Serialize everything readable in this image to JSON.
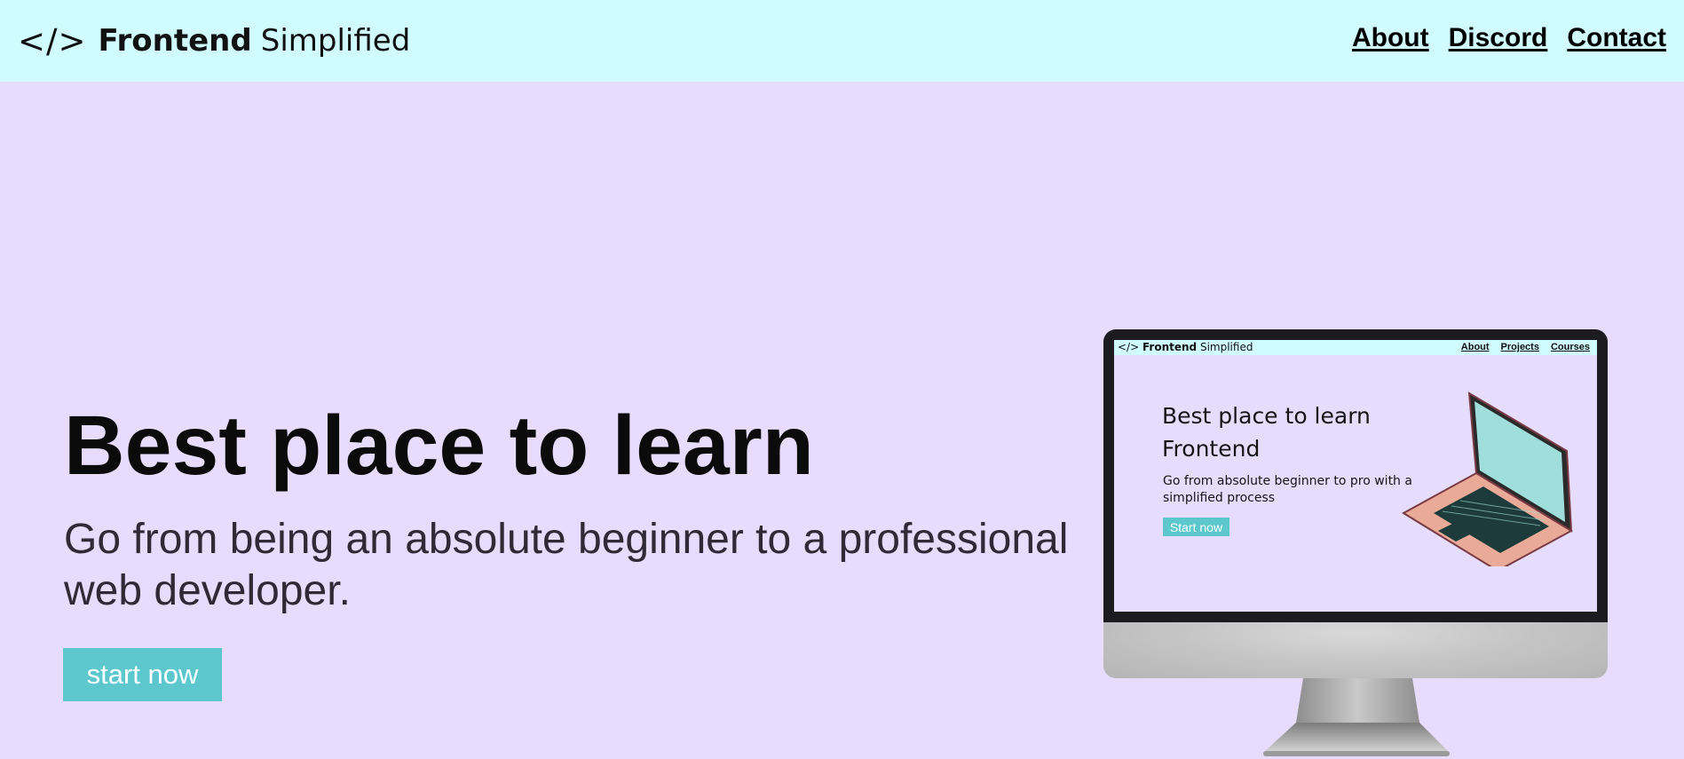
{
  "header": {
    "logo_mark": "</>",
    "logo_bold": "Frontend",
    "logo_light": "Simplified",
    "links": [
      "About",
      "Discord",
      "Contact"
    ]
  },
  "hero": {
    "title": "Best place to learn",
    "subtitle": "Go from being an absolute beginner to a professional web developer.",
    "cta_label": "start now"
  },
  "illustration": {
    "mini_logo_mark": "</>",
    "mini_logo_bold": "Frontend",
    "mini_logo_light": "Simplified",
    "mini_links": [
      "About",
      "Projects",
      "Courses"
    ],
    "mini_title": "Best place to learn Frontend",
    "mini_subtitle": "Go from absolute beginner to pro with a simplified process",
    "mini_button": "Start now"
  },
  "colors": {
    "page_background": "#e7dcfc",
    "nav_background": "#d0fbff",
    "accent": "#5cc8ce",
    "text_dark": "#0b0b0b"
  }
}
